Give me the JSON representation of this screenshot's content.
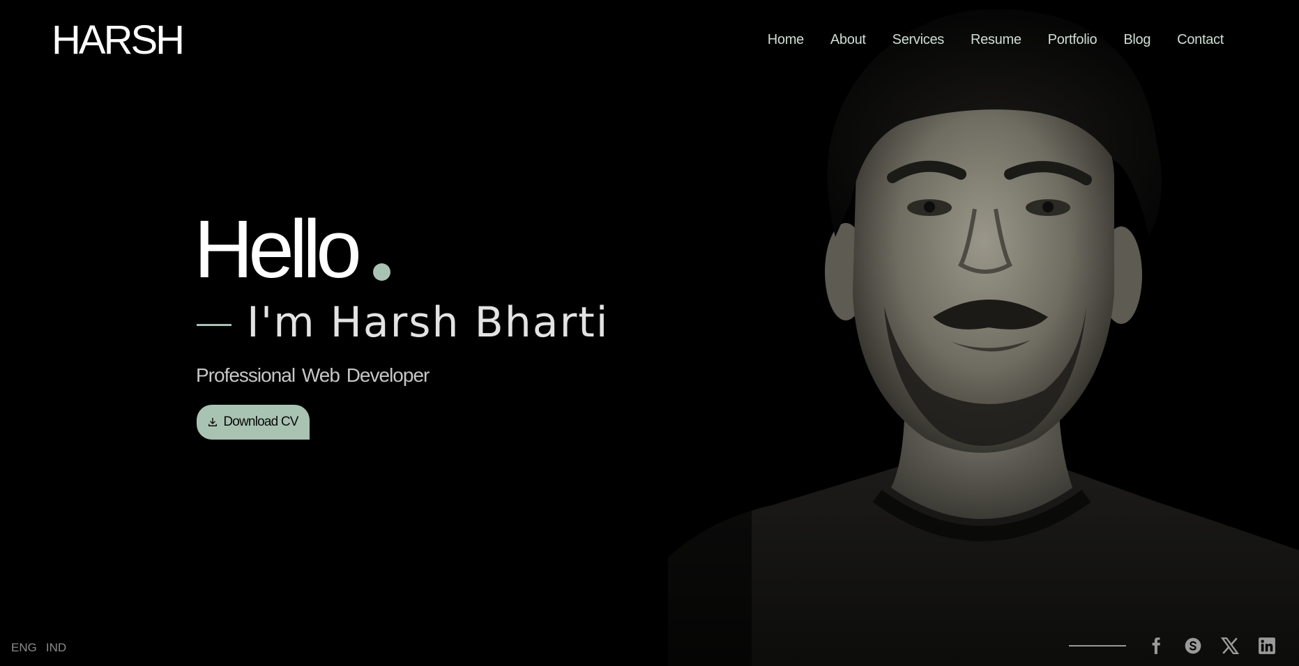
{
  "brand": {
    "logo": "HARSH"
  },
  "nav": {
    "items": [
      "Home",
      "About",
      "Services",
      "Resume",
      "Portfolio",
      "Blog",
      "Contact"
    ]
  },
  "hero": {
    "greeting": "Hello",
    "intro": "I'm Harsh Bharti",
    "role": "Professional Web Developer",
    "cta_label": "Download CV"
  },
  "footer": {
    "languages": [
      "ENG",
      "IND"
    ],
    "social": [
      "facebook-icon",
      "skype-icon",
      "x-twitter-icon",
      "linkedin-icon"
    ]
  },
  "colors": {
    "background": "#000000",
    "accent": "#a9c3b3",
    "nav_text": "#cfded5",
    "heading": "#ffffff"
  }
}
